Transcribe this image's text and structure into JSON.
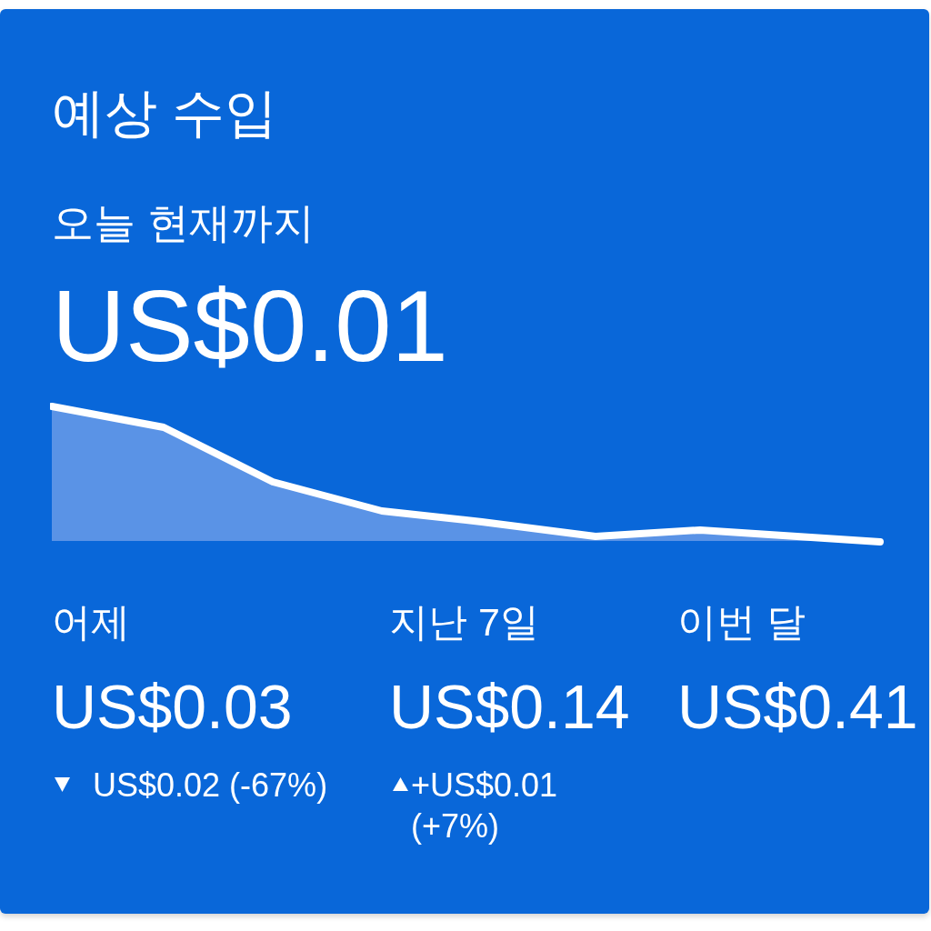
{
  "card": {
    "title": "예상 수입",
    "subtitle": "오늘 현재까지",
    "amount": "US$0.01"
  },
  "stats": [
    {
      "label": "어제",
      "value": "US$0.03",
      "change": {
        "increase": false,
        "text": "US$0.02 (-67%)"
      }
    },
    {
      "label": "지난 7일",
      "value": "US$0.14",
      "change": {
        "increase": true,
        "text": "+US$0.01 (+7%)"
      }
    },
    {
      "label": "이번 달",
      "value": "US$0.41"
    }
  ]
}
